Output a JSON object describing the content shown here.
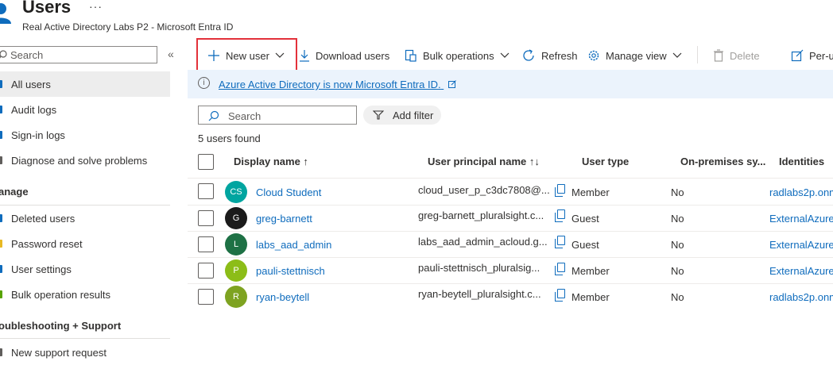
{
  "header": {
    "title": "Users",
    "more": "···",
    "subtitle": "Real Active Directory Labs P2 - Microsoft Entra ID"
  },
  "sidebar": {
    "search_placeholder": "Search",
    "collapse": "«",
    "items": [
      {
        "label": "All users"
      },
      {
        "label": "Audit logs"
      },
      {
        "label": "Sign-in logs"
      },
      {
        "label": "Diagnose and solve problems"
      }
    ],
    "manage_header": "anage",
    "manage_items": [
      {
        "label": "Deleted users"
      },
      {
        "label": "Password reset"
      },
      {
        "label": "User settings"
      },
      {
        "label": "Bulk operation results"
      }
    ],
    "support_header": "oubleshooting + Support",
    "support_items": [
      {
        "label": "New support request"
      }
    ]
  },
  "toolbar": {
    "new_user": "New user",
    "download": "Download users",
    "bulk": "Bulk operations",
    "refresh": "Refresh",
    "manage_view": "Manage view",
    "delete": "Delete",
    "per_user": "Per-u"
  },
  "banner": {
    "text": "Azure Active Directory is now Microsoft Entra ID."
  },
  "filter": {
    "search_placeholder": "Search",
    "add_filter": "Add filter",
    "count": "5 users found"
  },
  "table": {
    "columns": {
      "display_name": "Display name ↑",
      "upn": "User principal name ↑↓",
      "user_type": "User type",
      "onprem": "On-premises sy...",
      "identities": "Identities"
    },
    "rows": [
      {
        "initials": "CS",
        "color": "#00a5a0",
        "name": "Cloud Student",
        "upn": "cloud_user_p_c3dc7808@...",
        "type": "Member",
        "onprem": "No",
        "identity": "radlabs2p.onm"
      },
      {
        "initials": "G",
        "color": "#1b1b1b",
        "name": "greg-barnett",
        "upn": "greg-barnett_pluralsight.c...",
        "type": "Guest",
        "onprem": "No",
        "identity": "ExternalAzure..."
      },
      {
        "initials": "L",
        "color": "#1e7145",
        "name": "labs_aad_admin",
        "upn": "labs_aad_admin_acloud.g...",
        "type": "Guest",
        "onprem": "No",
        "identity": "ExternalAzure..."
      },
      {
        "initials": "P",
        "color": "#8cbd18",
        "name": "pauli-stettnisch",
        "upn": "pauli-stettnisch_pluralsig...",
        "type": "Member",
        "onprem": "No",
        "identity": "ExternalAzure..."
      },
      {
        "initials": "R",
        "color": "#7ea321",
        "name": "ryan-beytell",
        "upn": "ryan-beytell_pluralsight.c...",
        "type": "Member",
        "onprem": "No",
        "identity": "radlabs2p.onm"
      }
    ]
  },
  "colors": {
    "accent": "#0f6cbd",
    "highlight": "#e3313a",
    "banner_bg": "#ebf3fc"
  }
}
